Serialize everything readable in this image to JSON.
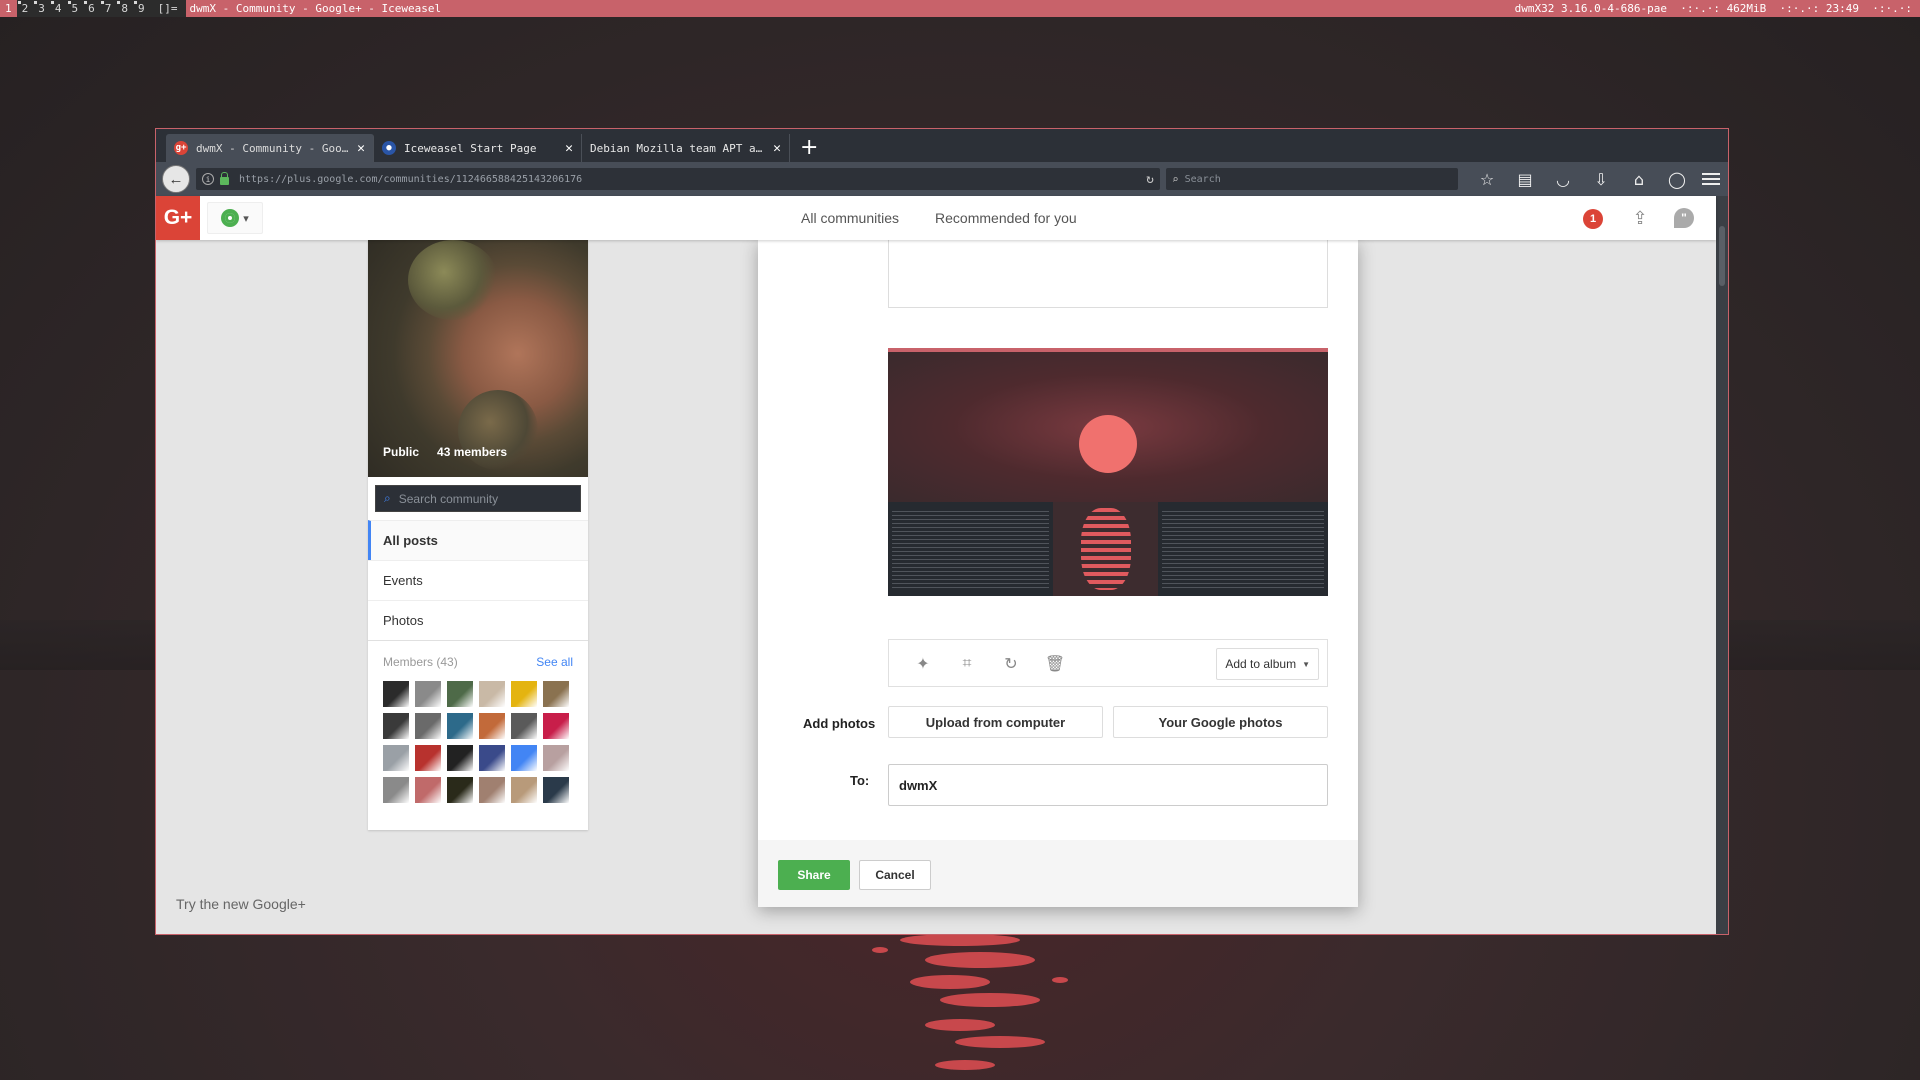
{
  "dwm": {
    "tags": [
      "1",
      "2",
      "3",
      "4",
      "5",
      "6",
      "7",
      "8",
      "9"
    ],
    "layout": "[]=",
    "window_title": "dwmX - Community - Google+ - Iceweasel",
    "status": "dwmX32 3.16.0-4-686-pae  ·:·.·: 462MiB  ·:·.·: 23:49  ·:·.·:"
  },
  "browser": {
    "tabs": [
      {
        "label": "dwmX - Community - Googl…",
        "favicon": "gplus-icon",
        "favicon_color": "#db4437"
      },
      {
        "label": "Iceweasel Start Page",
        "favicon": "iceweasel-icon",
        "favicon_color": "#2a55a6"
      },
      {
        "label": "Debian Mozilla team APT arch…",
        "favicon": "",
        "favicon_color": ""
      }
    ],
    "url": "https://plus.google.com/communities/112466588425143206176",
    "search_placeholder": "Search"
  },
  "gplus": {
    "logo": "G+",
    "nav": {
      "all_communities": "All communities",
      "recommended": "Recommended for you"
    },
    "notifications_count": "1",
    "brand_color": "#db4437"
  },
  "community": {
    "visibility": "Public",
    "members": "43 members",
    "search_placeholder": "Search community",
    "nav_items": [
      "All posts",
      "Events",
      "Photos"
    ],
    "members_label": "Members (43)",
    "see_all": "See all",
    "avatar_colors": [
      "#2b2b2b",
      "#8a8a8a",
      "#4e6a48",
      "#c9b9a6",
      "#e4b410",
      "#8a7250",
      "#3a3a3a",
      "#6a6a6a",
      "#2d6a8a",
      "#c26a3a",
      "#5a5a5a",
      "#c81e4a",
      "#9aa0a6",
      "#b8322e",
      "#222222",
      "#3a4a8a",
      "#4285f4",
      "#b8a0a0",
      "#8a8a8a",
      "#c06a6a",
      "#2a2a1a",
      "#a08070",
      "#b89a7a",
      "#2a3a4a"
    ]
  },
  "dialog": {
    "add_to_album": "Add to album",
    "add_photos_label": "Add photos",
    "upload_from_computer": "Upload from computer",
    "your_google_photos": "Your Google photos",
    "to_label": "To:",
    "to_value": "dwmX",
    "share": "Share",
    "cancel": "Cancel",
    "share_color": "#4caf50"
  },
  "footer": {
    "try_new": "Try the new Google+"
  }
}
